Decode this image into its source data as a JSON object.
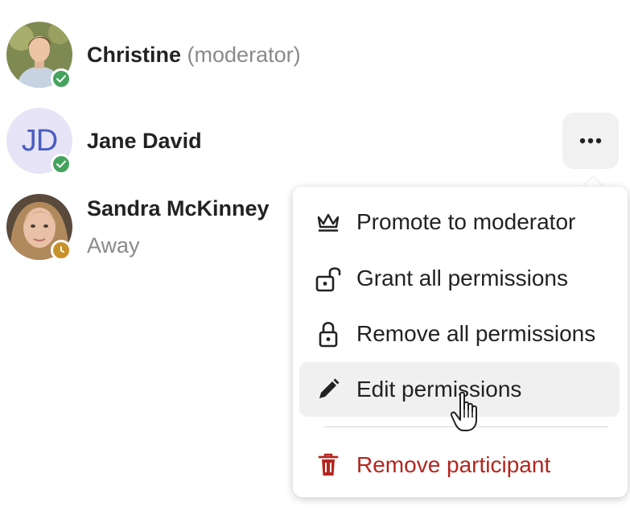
{
  "participants": [
    {
      "name": "Christine",
      "role": "(moderator)",
      "status": "online",
      "avatar": "photo"
    },
    {
      "name": "Jane David",
      "initials": "JD",
      "status": "online",
      "avatar": "initials"
    },
    {
      "name": "Sandra McKinney",
      "substatus": "Away",
      "status": "away",
      "avatar": "photo"
    }
  ],
  "menu": {
    "items": [
      {
        "label": "Promote to moderator",
        "icon": "crown-icon"
      },
      {
        "label": "Grant all permissions",
        "icon": "lock-open-icon"
      },
      {
        "label": "Remove all permissions",
        "icon": "lock-icon"
      },
      {
        "label": "Edit permissions",
        "icon": "pencil-icon",
        "hovered": true
      },
      {
        "label": "Remove participant",
        "icon": "trash-icon",
        "danger": true
      }
    ]
  },
  "colors": {
    "online": "#46a35e",
    "away": "#c9912b",
    "danger": "#b3261e",
    "initials_bg": "#e6e4f6",
    "initials_fg": "#4b5ec2"
  }
}
